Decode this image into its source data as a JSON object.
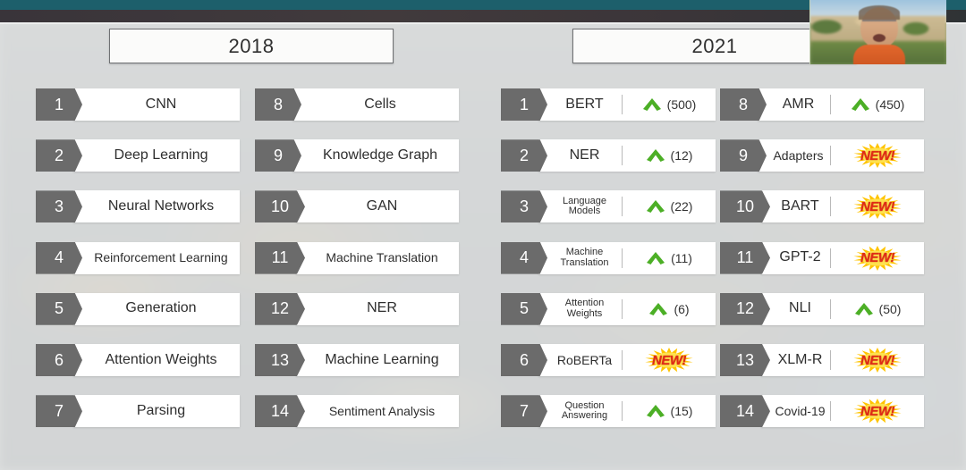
{
  "window": {
    "top_bar_teal_color": "#1d5f6b",
    "top_bar_dark_color": "#3b3539",
    "background_color": "#c9cbcb"
  },
  "slide": {
    "panels": [
      {
        "year_label": "2018",
        "has_trend_column": false,
        "columns": [
          {
            "items": [
              {
                "rank": "1",
                "label": "CNN",
                "size": "lg"
              },
              {
                "rank": "2",
                "label": "Deep Learning",
                "size": "lg"
              },
              {
                "rank": "3",
                "label": "Neural Networks",
                "size": "lg"
              },
              {
                "rank": "4",
                "label": "Reinforcement Learning",
                "size": "md"
              },
              {
                "rank": "5",
                "label": "Generation",
                "size": "lg"
              },
              {
                "rank": "6",
                "label": "Attention Weights",
                "size": "lg"
              },
              {
                "rank": "7",
                "label": "Parsing",
                "size": "lg"
              }
            ]
          },
          {
            "items": [
              {
                "rank": "8",
                "label": "Cells",
                "size": "lg"
              },
              {
                "rank": "9",
                "label": "Knowledge Graph",
                "size": "lg"
              },
              {
                "rank": "10",
                "label": "GAN",
                "size": "lg"
              },
              {
                "rank": "11",
                "label": "Machine Translation",
                "size": "md"
              },
              {
                "rank": "12",
                "label": "NER",
                "size": "lg"
              },
              {
                "rank": "13",
                "label": "Machine Learning",
                "size": "lg"
              },
              {
                "rank": "14",
                "label": "Sentiment Analysis",
                "size": "md"
              }
            ]
          }
        ]
      },
      {
        "year_label": "2021",
        "has_trend_column": true,
        "columns": [
          {
            "items": [
              {
                "rank": "1",
                "label": "BERT",
                "size": "lg",
                "trend": "up",
                "count": "(500)"
              },
              {
                "rank": "2",
                "label": "NER",
                "size": "lg",
                "trend": "up",
                "count": "(12)"
              },
              {
                "rank": "3",
                "label": "Language Models",
                "label_line1": "Language",
                "label_line2": "Models",
                "size": "sm",
                "trend": "up",
                "count": "(22)"
              },
              {
                "rank": "4",
                "label": "Machine Translation",
                "label_line1": "Machine",
                "label_line2": "Translation",
                "size": "sm",
                "trend": "up",
                "count": "(11)"
              },
              {
                "rank": "5",
                "label": "Attention Weights",
                "label_line1": "Attention",
                "label_line2": "Weights",
                "size": "sm",
                "trend": "up",
                "count": "(6)"
              },
              {
                "rank": "6",
                "label": "RoBERTa",
                "size": "md",
                "trend": "new",
                "count": "NEW!"
              },
              {
                "rank": "7",
                "label": "Question Answering",
                "label_line1": "Question",
                "label_line2": "Answering",
                "size": "sm",
                "trend": "up",
                "count": "(15)"
              }
            ]
          },
          {
            "items": [
              {
                "rank": "8",
                "label": "AMR",
                "size": "lg",
                "trend": "up",
                "count": "(450)"
              },
              {
                "rank": "9",
                "label": "Adapters",
                "size": "md",
                "trend": "new",
                "count": "NEW!"
              },
              {
                "rank": "10",
                "label": "BART",
                "size": "lg",
                "trend": "new",
                "count": "NEW!"
              },
              {
                "rank": "11",
                "label": "GPT-2",
                "size": "lg",
                "trend": "new",
                "count": "NEW!"
              },
              {
                "rank": "12",
                "label": "NLI",
                "size": "lg",
                "trend": "up",
                "count": "(50)"
              },
              {
                "rank": "13",
                "label": "XLM-R",
                "size": "lg",
                "trend": "new",
                "count": "NEW!"
              },
              {
                "rank": "14",
                "label": "Covid-19",
                "size": "md",
                "trend": "new",
                "count": "NEW!"
              }
            ]
          }
        ]
      }
    ]
  },
  "styles": {
    "badge_color": "#6b6b6b",
    "bar_color": "#ffffff",
    "arrow_up_color": "#4caf26",
    "new_badge_star_color": "#ffd400",
    "new_badge_text_color": "#e02b16"
  },
  "webcam": {
    "label": "presenter-webcam"
  }
}
